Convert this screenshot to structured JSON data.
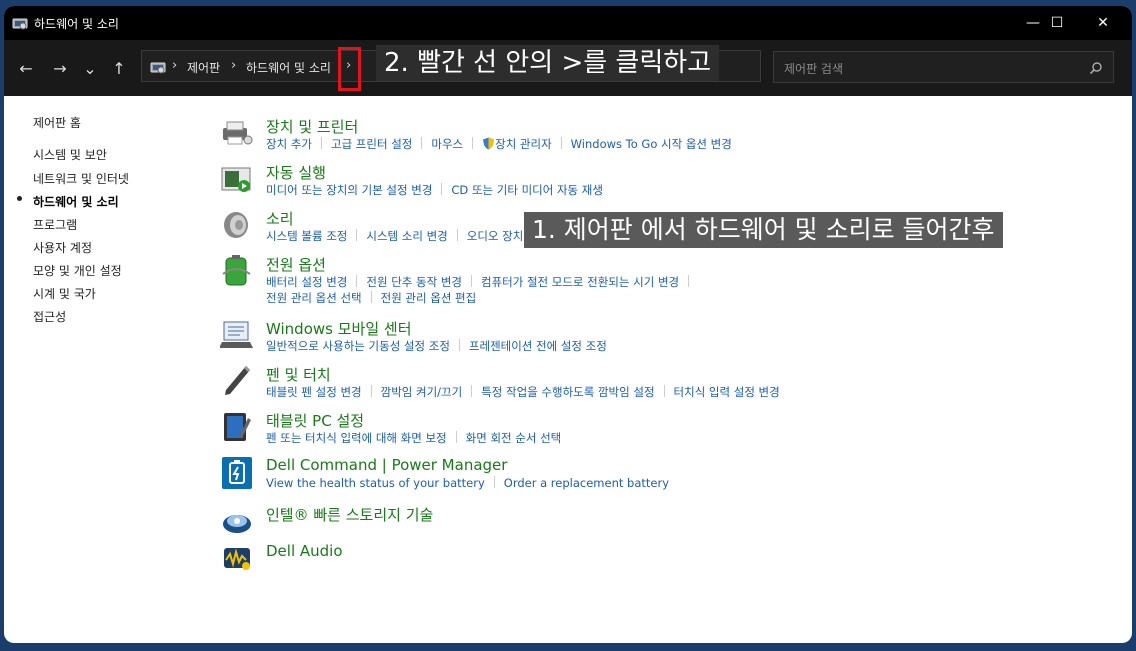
{
  "window": {
    "title": "하드웨어 및 소리",
    "controls": {
      "minimize": "—",
      "maximize": "☐",
      "close": "✕"
    }
  },
  "nav": {
    "back": "←",
    "forward": "→",
    "history": "⌄",
    "up": "↑",
    "breadcrumb": [
      "제어판",
      "하드웨어 및 소리"
    ],
    "sep": "›",
    "search_placeholder": "제어판 검색"
  },
  "annotations": {
    "step1": "1.  제어판 에서 하드웨어 및 소리로 들어간후",
    "step2": "2.  빨간 선 안의 >를 클릭하고"
  },
  "sidebar": {
    "items": [
      {
        "label": "제어판 홈"
      },
      {
        "label": "시스템 및 보안"
      },
      {
        "label": "네트워크 및 인터넷"
      },
      {
        "label": "하드웨어 및 소리"
      },
      {
        "label": "프로그램"
      },
      {
        "label": "사용자 계정"
      },
      {
        "label": "모양 및 개인 설정"
      },
      {
        "label": "시계 및 국가"
      },
      {
        "label": "접근성"
      }
    ]
  },
  "categories": [
    {
      "title": "장치 및 프린터",
      "icon": "printer-icon",
      "links": [
        "장치 추가",
        "고급 프린터 설정",
        "마우스",
        "장치 관리자",
        "Windows To Go 시작 옵션 변경"
      ]
    },
    {
      "title": "자동 실행",
      "icon": "autoplay-icon",
      "links": [
        "미디어 또는 장치의 기본 설정 변경",
        "CD 또는 기타 미디어 자동 재생"
      ]
    },
    {
      "title": "소리",
      "icon": "speaker-icon",
      "links": [
        "시스템 볼륨 조정",
        "시스템 소리 변경",
        "오디오 장치 관리"
      ]
    },
    {
      "title": "전원 옵션",
      "icon": "battery-icon",
      "links": [
        "배터리 설정 변경",
        "전원 단추 동작 변경",
        "컴퓨터가 절전 모드로 전환되는 시기 변경"
      ],
      "links2": [
        "전원 관리 옵션 선택",
        "전원 관리 옵션 편집"
      ]
    },
    {
      "title": "Windows 모바일 센터",
      "icon": "mobility-center-icon",
      "links": [
        "일반적으로 사용하는 기동성 설정 조정",
        "프레젠테이션 전에 설정 조정"
      ]
    },
    {
      "title": "펜 및 터치",
      "icon": "pen-icon",
      "links": [
        "태블릿 펜 설정 변경",
        "깜박임 켜기/끄기",
        "특정 작업을 수행하도록 깜박임 설정",
        "터치식 입력 설정 변경"
      ]
    },
    {
      "title": "태블릿 PC 설정",
      "icon": "tablet-icon",
      "links": [
        "펜 또는 터치식 입력에 대해 화면 보정",
        "화면 회전 순서 선택"
      ]
    },
    {
      "title": "Dell Command | Power Manager",
      "icon": "dell-power-icon",
      "links": [
        "View the health status of your battery",
        "Order a replacement battery"
      ]
    },
    {
      "title": "인텔® 빠른 스토리지 기술",
      "icon": "intel-storage-icon",
      "links": []
    },
    {
      "title": "Dell Audio",
      "icon": "dell-audio-icon",
      "links": []
    }
  ]
}
